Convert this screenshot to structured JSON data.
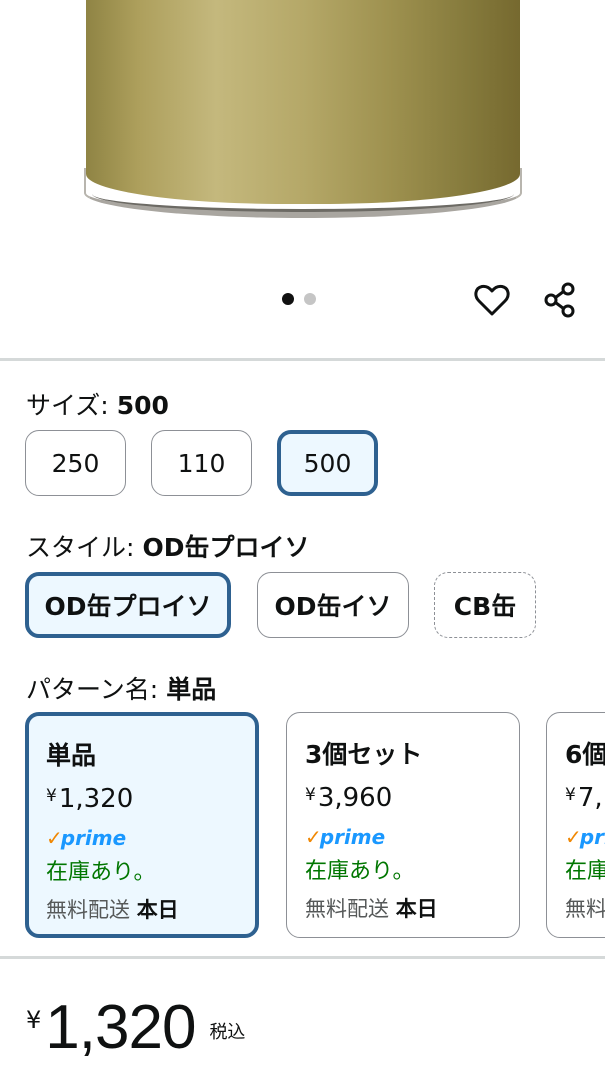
{
  "gallery": {
    "dots_total": 2,
    "active_dot": 1,
    "favorite_icon": "heart-icon",
    "share_icon": "share-icon"
  },
  "size": {
    "label": "サイズ:",
    "selected": "500",
    "options": [
      "250",
      "110",
      "500"
    ]
  },
  "style": {
    "label": "スタイル:",
    "selected": "OD缶プロイソ",
    "options": [
      "OD缶プロイソ",
      "OD缶イソ",
      "CB缶"
    ]
  },
  "pattern": {
    "label": "パターン名:",
    "selected": "単品",
    "cards": [
      {
        "title": "単品",
        "currency": "¥",
        "price": "1,320",
        "prime": "prime",
        "stock": "在庫あり。",
        "ship_label": "無料配送",
        "ship_day": "本日"
      },
      {
        "title": "3個セット",
        "currency": "¥",
        "price": "3,960",
        "prime": "prime",
        "stock": "在庫あり。",
        "ship_label": "無料配送",
        "ship_day": "本日"
      },
      {
        "title": "6個",
        "currency": "¥",
        "price": "7,",
        "prime": "pri",
        "stock": "在庫",
        "ship_label": "無料",
        "ship_day": ""
      }
    ]
  },
  "price": {
    "currency": "¥",
    "amount": "1,320",
    "tax_note": "税込"
  },
  "colors": {
    "selected_border": "#2e6190",
    "selected_bg": "#edf8ff",
    "prime_blue": "#1a98ff",
    "prime_check": "#f08804",
    "in_stock": "#007600"
  }
}
